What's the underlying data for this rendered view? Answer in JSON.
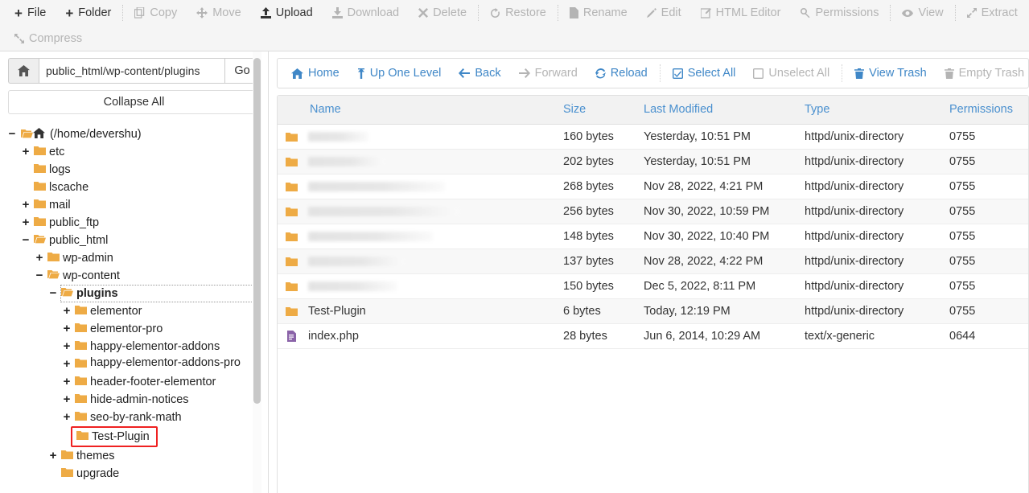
{
  "toolbar": {
    "row1": [
      {
        "label": "File",
        "icon": "plus-icon",
        "enabled": true
      },
      {
        "label": "Folder",
        "icon": "plus-icon",
        "enabled": true
      },
      {
        "label": "Copy",
        "icon": "copy-icon",
        "enabled": false
      },
      {
        "label": "Move",
        "icon": "move-icon",
        "enabled": false
      },
      {
        "label": "Upload",
        "icon": "upload-icon",
        "enabled": true
      },
      {
        "label": "Download",
        "icon": "download-icon",
        "enabled": false
      },
      {
        "label": "Delete",
        "icon": "delete-x-icon",
        "enabled": false
      },
      {
        "label": "Restore",
        "icon": "restore-icon",
        "enabled": false
      },
      {
        "label": "Rename",
        "icon": "file-icon",
        "enabled": false
      },
      {
        "label": "Edit",
        "icon": "pencil-icon",
        "enabled": false
      },
      {
        "label": "HTML Editor",
        "icon": "html-editor-icon",
        "enabled": false
      },
      {
        "label": "Permissions",
        "icon": "key-icon",
        "enabled": false
      },
      {
        "label": "View",
        "icon": "eye-icon",
        "enabled": false
      },
      {
        "label": "Extract",
        "icon": "extract-icon",
        "enabled": false
      }
    ],
    "row2": [
      {
        "label": "Compress",
        "icon": "compress-icon",
        "enabled": false
      }
    ]
  },
  "sidebar": {
    "home_icon": "home-icon",
    "path_value": "public_html/wp-content/plugins",
    "path_placeholder": "",
    "go_label": "Go",
    "collapse_all_label": "Collapse All",
    "tree": [
      {
        "label": "(/home/devershu)",
        "toggle": "−",
        "indent": 0,
        "icon": "open-folder-home-icon"
      },
      {
        "label": "etc",
        "toggle": "+",
        "indent": 1,
        "icon": "folder-icon"
      },
      {
        "label": "logs",
        "toggle": "",
        "indent": 1,
        "icon": "folder-icon"
      },
      {
        "label": "lscache",
        "toggle": "",
        "indent": 1,
        "icon": "folder-icon"
      },
      {
        "label": "mail",
        "toggle": "+",
        "indent": 1,
        "icon": "folder-icon"
      },
      {
        "label": "public_ftp",
        "toggle": "+",
        "indent": 1,
        "icon": "folder-icon"
      },
      {
        "label": "public_html",
        "toggle": "−",
        "indent": 1,
        "icon": "open-folder-icon"
      },
      {
        "label": "wp-admin",
        "toggle": "+",
        "indent": 2,
        "icon": "folder-icon"
      },
      {
        "label": "wp-content",
        "toggle": "−",
        "indent": 2,
        "icon": "open-folder-icon"
      },
      {
        "label": "plugins",
        "toggle": "−",
        "indent": 3,
        "icon": "open-folder-icon",
        "selected": true
      },
      {
        "label": "elementor",
        "toggle": "+",
        "indent": 4,
        "icon": "folder-icon"
      },
      {
        "label": "elementor-pro",
        "toggle": "+",
        "indent": 4,
        "icon": "folder-icon"
      },
      {
        "label": "happy-elementor-addons",
        "toggle": "+",
        "indent": 4,
        "icon": "folder-icon"
      },
      {
        "label": "happy-elementor-addons-pro",
        "toggle": "+",
        "indent": 4,
        "icon": "folder-icon",
        "wrap": true
      },
      {
        "label": "header-footer-elementor",
        "toggle": "+",
        "indent": 4,
        "icon": "folder-icon"
      },
      {
        "label": "hide-admin-notices",
        "toggle": "+",
        "indent": 4,
        "icon": "folder-icon"
      },
      {
        "label": "seo-by-rank-math",
        "toggle": "+",
        "indent": 4,
        "icon": "folder-icon"
      },
      {
        "label": "Test-Plugin",
        "toggle": "",
        "indent": 4,
        "icon": "folder-icon",
        "highlighted": true
      },
      {
        "label": "themes",
        "toggle": "+",
        "indent": 3,
        "icon": "folder-icon"
      },
      {
        "label": "upgrade",
        "toggle": "",
        "indent": 3,
        "icon": "folder-icon"
      }
    ]
  },
  "nav": [
    {
      "label": "Home",
      "icon": "home-icon",
      "enabled": true
    },
    {
      "label": "Up One Level",
      "icon": "up-arrow-icon",
      "enabled": true
    },
    {
      "label": "Back",
      "icon": "left-arrow-icon",
      "enabled": true
    },
    {
      "label": "Forward",
      "icon": "right-arrow-icon",
      "enabled": false
    },
    {
      "label": "Reload",
      "icon": "reload-icon",
      "enabled": true
    },
    {
      "label": "Select All",
      "icon": "checked-box-icon",
      "enabled": true
    },
    {
      "label": "Unselect All",
      "icon": "empty-box-icon",
      "enabled": false
    },
    {
      "label": "View Trash",
      "icon": "trash-icon",
      "enabled": true
    },
    {
      "label": "Empty Trash",
      "icon": "trash-icon",
      "enabled": false
    }
  ],
  "table": {
    "columns": [
      "Name",
      "Size",
      "Last Modified",
      "Type",
      "Permissions"
    ],
    "rows": [
      {
        "name": "",
        "redacted": true,
        "redacted_width": 75,
        "size": "160 bytes",
        "modified": "Yesterday, 10:51 PM",
        "type": "httpd/unix-directory",
        "permissions": "0755",
        "icon": "folder-icon"
      },
      {
        "name": "",
        "redacted": true,
        "redacted_width": 95,
        "size": "202 bytes",
        "modified": "Yesterday, 10:51 PM",
        "type": "httpd/unix-directory",
        "permissions": "0755",
        "icon": "folder-icon"
      },
      {
        "name": "",
        "redacted": true,
        "redacted_width": 170,
        "size": "268 bytes",
        "modified": "Nov 28, 2022, 4:21 PM",
        "type": "httpd/unix-directory",
        "permissions": "0755",
        "icon": "folder-icon"
      },
      {
        "name": "",
        "redacted": true,
        "redacted_width": 188,
        "size": "256 bytes",
        "modified": "Nov 30, 2022, 10:59 PM",
        "type": "httpd/unix-directory",
        "permissions": "0755",
        "icon": "folder-icon"
      },
      {
        "name": "",
        "redacted": true,
        "redacted_width": 155,
        "size": "148 bytes",
        "modified": "Nov 30, 2022, 10:40 PM",
        "type": "httpd/unix-directory",
        "permissions": "0755",
        "icon": "folder-icon"
      },
      {
        "name": "",
        "redacted": true,
        "redacted_width": 120,
        "size": "137 bytes",
        "modified": "Nov 28, 2022, 4:22 PM",
        "type": "httpd/unix-directory",
        "permissions": "0755",
        "icon": "folder-icon"
      },
      {
        "name": "",
        "redacted": true,
        "redacted_width": 110,
        "size": "150 bytes",
        "modified": "Dec 5, 2022, 8:11 PM",
        "type": "httpd/unix-directory",
        "permissions": "0755",
        "icon": "folder-icon"
      },
      {
        "name": "Test-Plugin",
        "redacted": false,
        "size": "6 bytes",
        "modified": "Today, 12:19 PM",
        "type": "httpd/unix-directory",
        "permissions": "0755",
        "icon": "folder-icon"
      },
      {
        "name": "index.php",
        "redacted": false,
        "size": "28 bytes",
        "modified": "Jun 6, 2014, 10:29 AM",
        "type": "text/x-generic",
        "permissions": "0644",
        "icon": "php-file-icon"
      }
    ]
  },
  "colors": {
    "folder": "#eeab45",
    "file_purple": "#8a63a8",
    "link_blue": "#3f87c7",
    "header_bg": "#f2f2f2",
    "disabled": "#b4b4b4",
    "highlight_red": "#ef2121"
  }
}
